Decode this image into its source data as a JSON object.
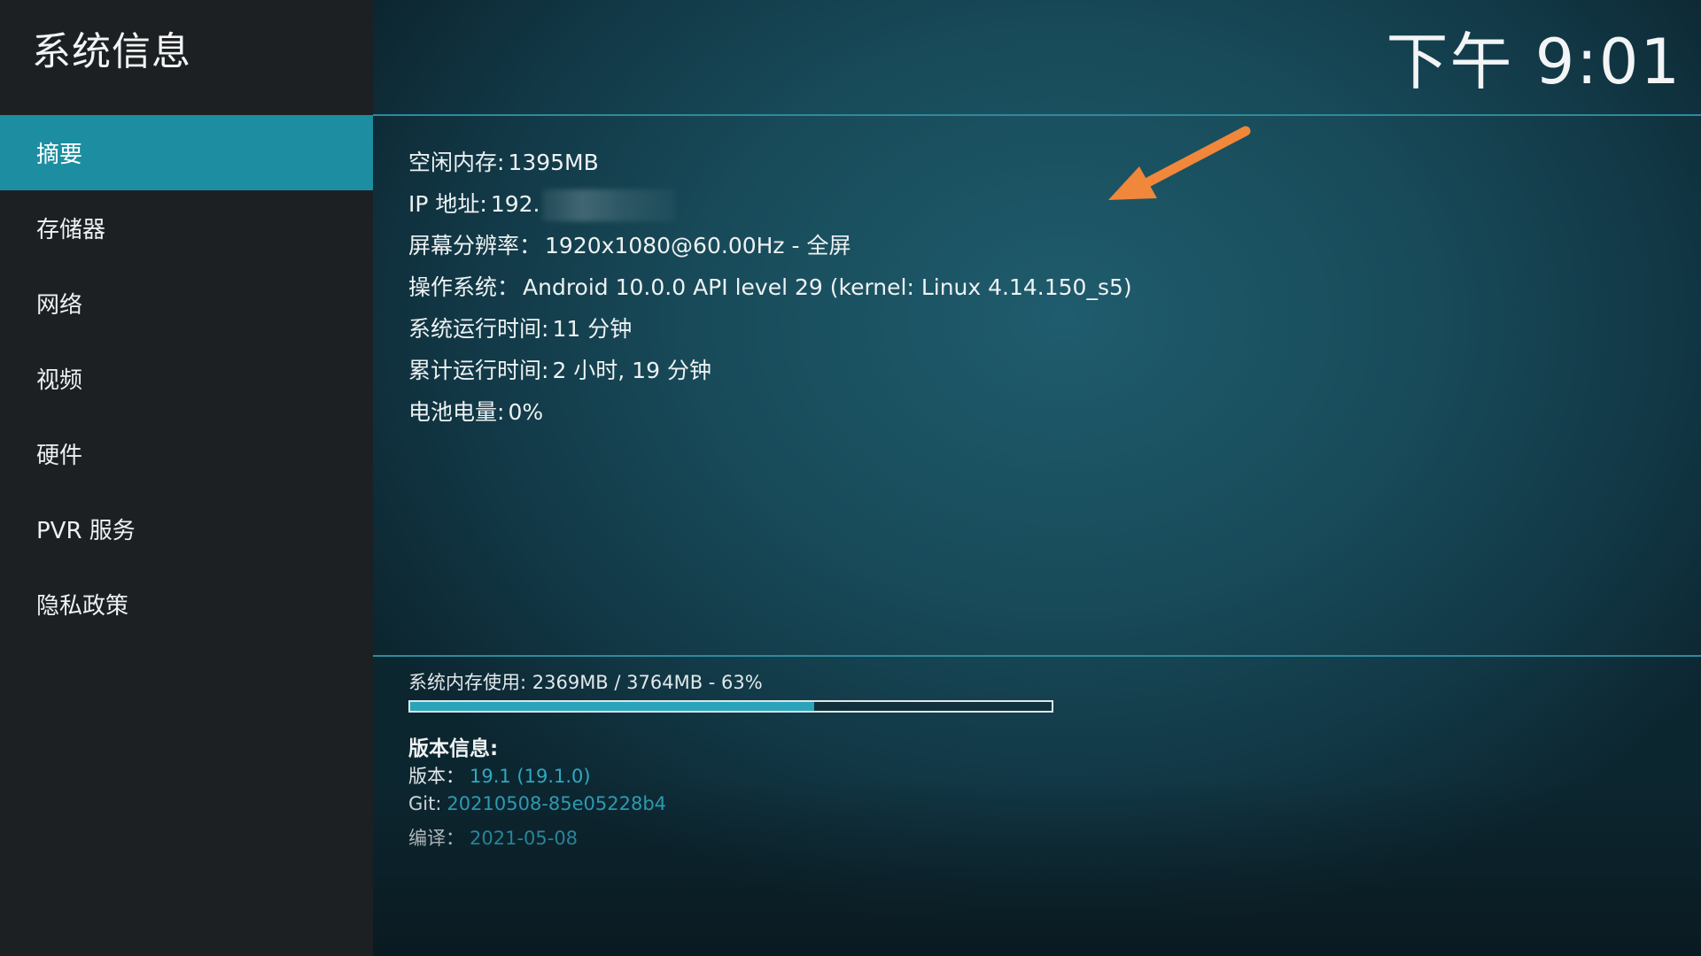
{
  "header": {
    "title": "系统信息",
    "clock": "下午 9:01"
  },
  "sidebar": {
    "items": [
      {
        "label": "摘要",
        "active": true
      },
      {
        "label": "存储器",
        "active": false
      },
      {
        "label": "网络",
        "active": false
      },
      {
        "label": "视频",
        "active": false
      },
      {
        "label": "硬件",
        "active": false
      },
      {
        "label": "PVR 服务",
        "active": false
      },
      {
        "label": "隐私政策",
        "active": false
      }
    ]
  },
  "summary": {
    "free_memory": {
      "label": "空闲内存:",
      "value": "1395MB"
    },
    "ip": {
      "label": "IP 地址:",
      "value": "192."
    },
    "resolution": {
      "label": "屏幕分辨率：",
      "value": "1920x1080@60.00Hz - 全屏"
    },
    "os": {
      "label": "操作系统：",
      "value": "Android 10.0.0 API level 29 (kernel: Linux 4.14.150_s5)"
    },
    "uptime": {
      "label": "系统运行时间:",
      "value": "11 分钟"
    },
    "total_uptime": {
      "label": "累计运行时间:",
      "value": "2 小时, 19 分钟"
    },
    "battery": {
      "label": "电池电量:",
      "value": "0%"
    }
  },
  "memory": {
    "usage_text": "系统内存使用: 2369MB / 3764MB - 63%",
    "percent": 63
  },
  "version": {
    "heading": "版本信息:",
    "version_label": "版本：",
    "version_value": "19.1 (19.1.0)",
    "git_label": "Git:",
    "git_value": "20210508-85e05228b4",
    "build_label": "编译：",
    "build_value": "2021-05-08"
  },
  "colors": {
    "accent": "#1d8ea1",
    "link": "#30a9c2",
    "arrow": "#f0873a"
  }
}
